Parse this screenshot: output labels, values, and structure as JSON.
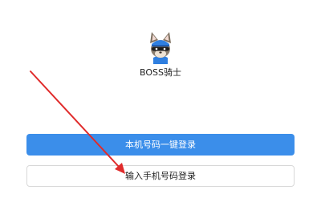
{
  "app": {
    "name": "BOSS骑士",
    "logo_icon": "knight-mascot-icon"
  },
  "login": {
    "one_click_label": "本机号码一键登录",
    "phone_login_label": "输入手机号码登录"
  },
  "colors": {
    "primary": "#3b8eea",
    "annotation_arrow": "#e02b2b"
  }
}
